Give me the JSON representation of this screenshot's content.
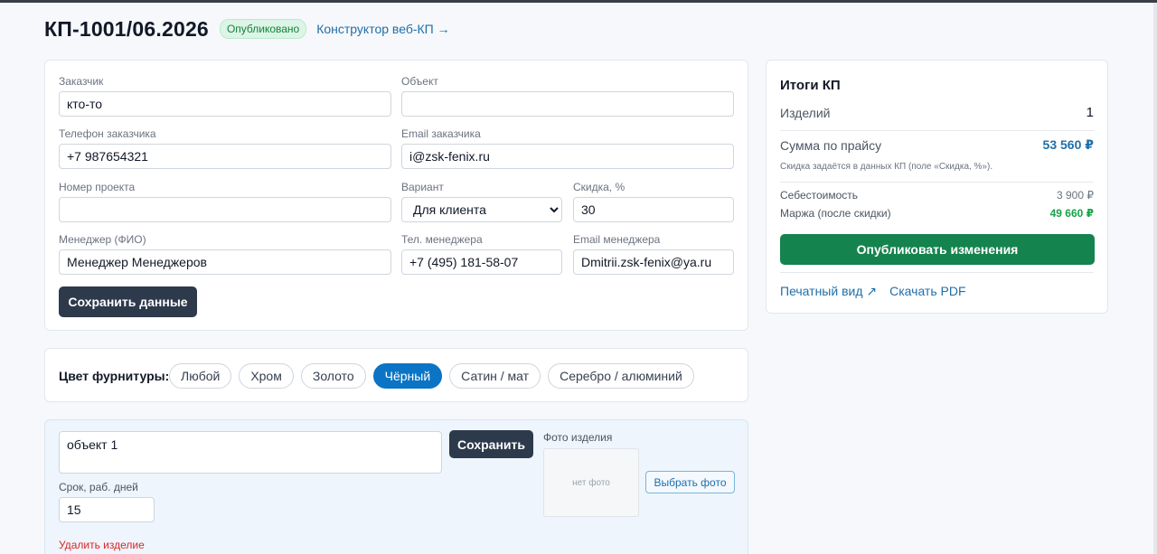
{
  "header": {
    "title": "КП-1001/06.2026",
    "status_badge": "Опубликовано",
    "constructor_link": "Конструктор веб-КП →"
  },
  "form": {
    "customer": {
      "label": "Заказчик",
      "value": "кто-то"
    },
    "object": {
      "label": "Объект",
      "value": ""
    },
    "customer_phone": {
      "label": "Телефон заказчика",
      "value": "+7 987654321"
    },
    "customer_email": {
      "label": "Email заказчика",
      "value": "i@zsk-fenix.ru"
    },
    "project_number": {
      "label": "Номер проекта",
      "value": ""
    },
    "variant": {
      "label": "Вариант",
      "selected": "Для клиента"
    },
    "discount": {
      "label": "Скидка, %",
      "value": "30"
    },
    "manager_name": {
      "label": "Менеджер (ФИО)",
      "value": "Менеджер Менеджеров"
    },
    "manager_phone": {
      "label": "Тел. менеджера",
      "value": "+7 (495) 181-58-07"
    },
    "manager_email": {
      "label": "Email менеджера",
      "value": "Dmitrii.zsk-fenix@ya.ru"
    },
    "save_button": "Сохранить данные"
  },
  "fittings": {
    "label": "Цвет фурнитуры:",
    "chips": [
      "Любой",
      "Хром",
      "Золото",
      "Чёрный",
      "Сатин / мат",
      "Серебро / алюминий"
    ],
    "active": "Чёрный"
  },
  "item": {
    "description": "объект 1",
    "save_button": "Сохранить",
    "term_label": "Срок, раб. дней",
    "term_value": "15",
    "photo_label": "Фото изделия",
    "photo_placeholder": "нет фото",
    "choose_photo_button": "Выбрать фото",
    "delete_link": "Удалить изделие"
  },
  "summary": {
    "title": "Итоги КП",
    "items_label": "Изделий",
    "items_value": "1",
    "price_label": "Сумма по прайсу",
    "price_value": "53 560 ₽",
    "discount_note": "Скидка задаётся в данных КП (поле «Скидка, %»).",
    "cost_label": "Себестоимость",
    "cost_value": "3 900 ₽",
    "margin_label": "Маржа (после скидки)",
    "margin_value": "49 660 ₽",
    "publish_button": "Опубликовать изменения",
    "print_link": "Печатный вид ↗",
    "pdf_link": "Скачать PDF"
  },
  "colors": {
    "accent_blue": "#0b74c4",
    "dark_button": "#2d3a4b",
    "green_button": "#15834e",
    "price_blue": "#1f6fa8",
    "margin_green": "#16a34a",
    "danger_red": "#dc2626"
  }
}
